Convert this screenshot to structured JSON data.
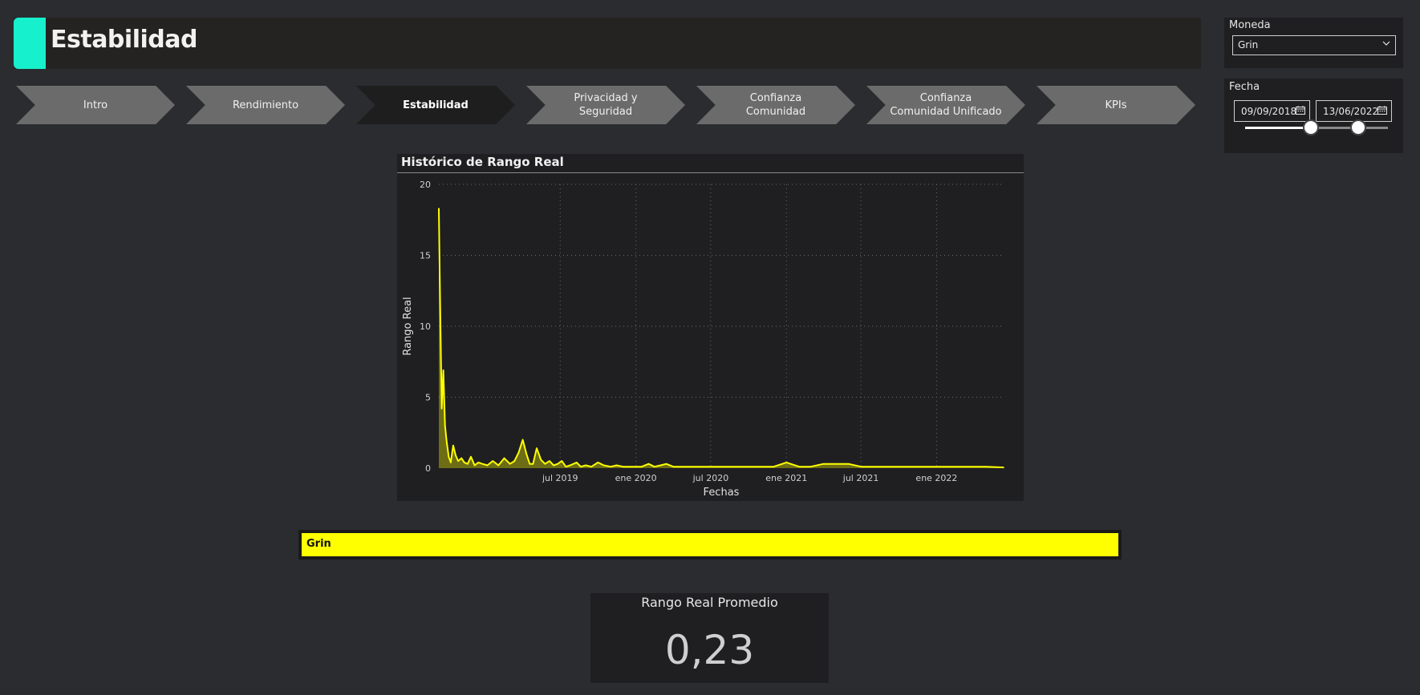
{
  "header": {
    "title": "Estabilidad"
  },
  "nav": {
    "tabs": [
      {
        "label": "Intro",
        "active": false
      },
      {
        "label": "Rendimiento",
        "active": false
      },
      {
        "label": "Estabilidad",
        "active": true
      },
      {
        "label": "Privacidad y Seguridad",
        "active": false
      },
      {
        "label": "Confianza Comunidad",
        "active": false
      },
      {
        "label": "Confianza Comunidad Unificado",
        "active": false
      },
      {
        "label": "KPIs",
        "active": false
      }
    ]
  },
  "moneda": {
    "label": "Moneda",
    "selected": "Grin"
  },
  "fecha": {
    "label": "Fecha",
    "start": "09/09/2018",
    "end": "13/06/2022",
    "range_fraction": [
      0.46,
      0.79
    ]
  },
  "legend": {
    "label": "Grin"
  },
  "kpi": {
    "label": "Rango Real Promedio",
    "value": "0,23"
  },
  "colors": {
    "accent": "#16f0cc",
    "series": "#ffff00",
    "active_tab": "#1e1e1e",
    "tab": "#6b6b6b"
  },
  "chart_data": {
    "type": "area",
    "title": "Histórico de Rango Real",
    "xlabel": "Fechas",
    "ylabel": "Rango Real",
    "ylim": [
      0,
      20
    ],
    "yticks": [
      0,
      5,
      10,
      15,
      20
    ],
    "xlim": [
      "2018-09-09",
      "2022-06-13"
    ],
    "xticks": [
      {
        "date": "2019-07-01",
        "label": "jul 2019"
      },
      {
        "date": "2020-01-01",
        "label": "ene 2020"
      },
      {
        "date": "2020-07-01",
        "label": "jul 2020"
      },
      {
        "date": "2021-01-01",
        "label": "ene 2021"
      },
      {
        "date": "2021-07-01",
        "label": "jul 2021"
      },
      {
        "date": "2022-01-01",
        "label": "ene 2022"
      }
    ],
    "grid": true,
    "series": [
      {
        "name": "Grin",
        "color": "#ffff00",
        "x": [
          "2018-09-09",
          "2018-09-12",
          "2018-09-16",
          "2018-09-20",
          "2018-09-24",
          "2018-09-28",
          "2018-10-03",
          "2018-10-08",
          "2018-10-14",
          "2018-10-20",
          "2018-10-26",
          "2018-11-03",
          "2018-11-10",
          "2018-11-18",
          "2018-11-26",
          "2018-12-05",
          "2018-12-14",
          "2018-12-24",
          "2019-01-05",
          "2019-01-18",
          "2019-02-01",
          "2019-02-15",
          "2019-03-01",
          "2019-03-12",
          "2019-03-22",
          "2019-04-01",
          "2019-04-10",
          "2019-04-18",
          "2019-04-26",
          "2019-05-05",
          "2019-05-15",
          "2019-05-25",
          "2019-06-05",
          "2019-06-15",
          "2019-06-25",
          "2019-07-05",
          "2019-07-15",
          "2019-07-25",
          "2019-08-10",
          "2019-08-20",
          "2019-09-01",
          "2019-09-15",
          "2019-10-01",
          "2019-10-15",
          "2019-11-01",
          "2019-11-15",
          "2019-12-01",
          "2019-12-15",
          "2020-01-01",
          "2020-01-15",
          "2020-02-01",
          "2020-02-15",
          "2020-03-01",
          "2020-03-15",
          "2020-04-01",
          "2020-05-01",
          "2020-06-01",
          "2020-07-01",
          "2020-08-01",
          "2020-09-01",
          "2020-10-01",
          "2020-11-01",
          "2020-12-01",
          "2021-01-01",
          "2021-02-01",
          "2021-03-01",
          "2021-04-01",
          "2021-05-01",
          "2021-06-01",
          "2021-07-01",
          "2021-08-01",
          "2021-09-01",
          "2021-10-01",
          "2021-11-01",
          "2021-12-01",
          "2022-01-01",
          "2022-02-01",
          "2022-03-01",
          "2022-04-01",
          "2022-05-01",
          "2022-06-13"
        ],
        "values": [
          18.3,
          12.0,
          4.2,
          6.9,
          3.0,
          1.9,
          0.8,
          0.4,
          1.6,
          0.9,
          0.5,
          0.7,
          0.4,
          0.3,
          0.8,
          0.2,
          0.4,
          0.3,
          0.2,
          0.5,
          0.2,
          0.7,
          0.3,
          0.5,
          1.1,
          2.0,
          1.0,
          0.3,
          0.3,
          1.4,
          0.6,
          0.3,
          0.5,
          0.2,
          0.3,
          0.5,
          0.1,
          0.2,
          0.4,
          0.1,
          0.2,
          0.1,
          0.4,
          0.2,
          0.1,
          0.2,
          0.1,
          0.1,
          0.1,
          0.1,
          0.3,
          0.1,
          0.2,
          0.3,
          0.1,
          0.1,
          0.1,
          0.1,
          0.1,
          0.1,
          0.1,
          0.1,
          0.1,
          0.4,
          0.1,
          0.1,
          0.3,
          0.3,
          0.3,
          0.1,
          0.1,
          0.1,
          0.1,
          0.1,
          0.1,
          0.1,
          0.1,
          0.1,
          0.1,
          0.1,
          0.05
        ]
      }
    ]
  }
}
